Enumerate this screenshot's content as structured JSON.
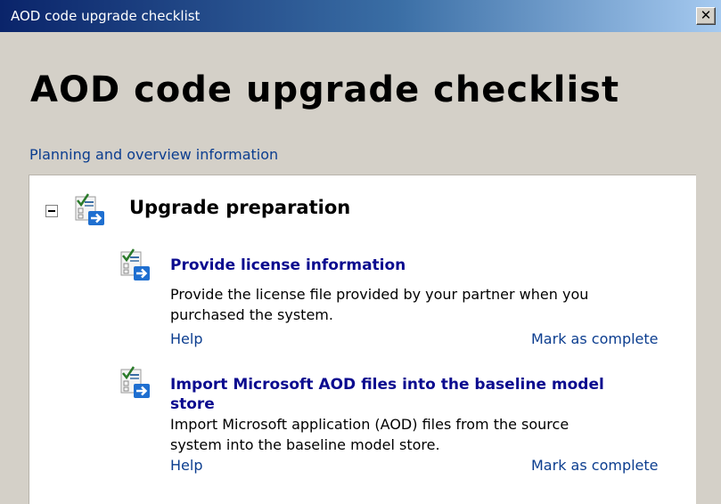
{
  "window": {
    "title": "AOD code upgrade checklist",
    "close_glyph": "✕"
  },
  "page": {
    "heading": "AOD code upgrade checklist",
    "planning_link": "Planning and overview information"
  },
  "section": {
    "title": "Upgrade preparation",
    "collapse_icon": "minus-box-icon",
    "icon": "checklist-arrow-icon"
  },
  "items": [
    {
      "title": "Provide license information",
      "description_line1": "Provide the license file provided by your partner when you",
      "description_line2": "purchased the system.",
      "help_label": "Help",
      "complete_label": "Mark as complete",
      "icon": "checklist-arrow-icon"
    },
    {
      "title_line1": "Import Microsoft AOD files into the baseline model",
      "title_line2": "store",
      "description_line1": "Import Microsoft application (AOD) files from the source",
      "description_line2": "system into the baseline model store.",
      "help_label": "Help",
      "complete_label": "Mark as complete",
      "icon": "checklist-arrow-icon"
    }
  ],
  "colors": {
    "title_bar_start": "#0a246a",
    "title_bar_end": "#a6caf0",
    "link": "#0b3d8f",
    "item_title": "#0b0b8f",
    "window_bg": "#d4d0c8"
  }
}
